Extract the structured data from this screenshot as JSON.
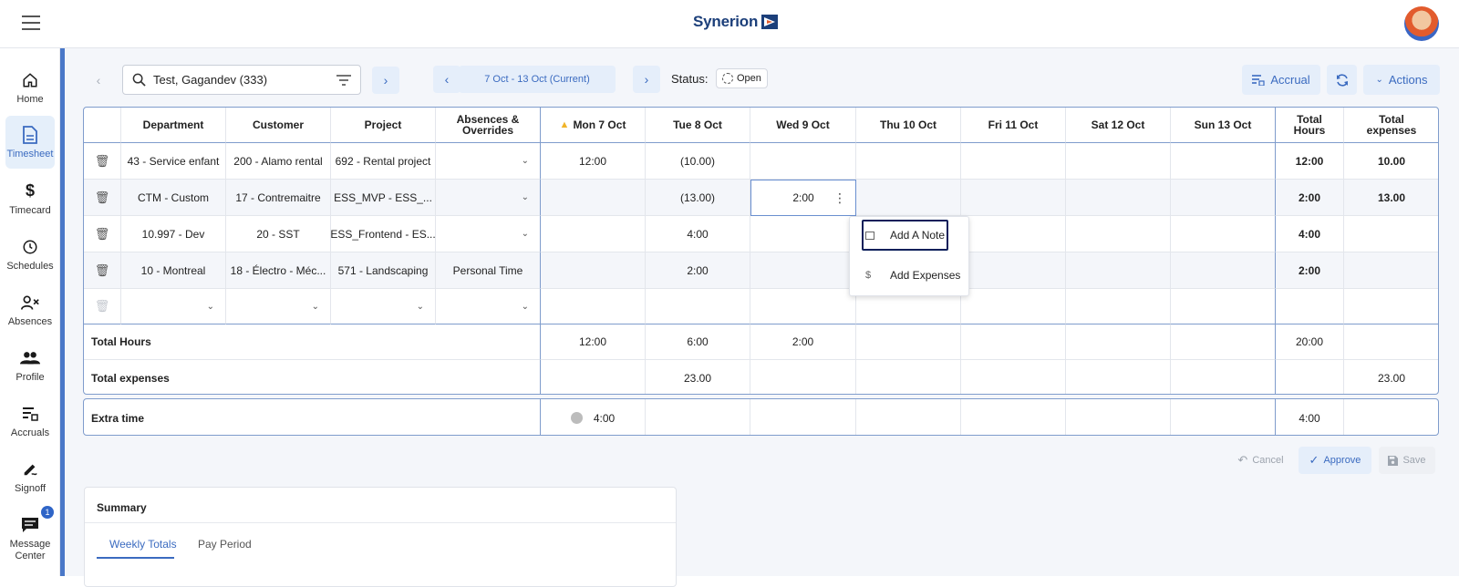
{
  "header": {
    "logo_text": "Synerion",
    "brand_color": "#1c3f7a",
    "accent_color": "#3b6bc0"
  },
  "sidebar": {
    "items": [
      {
        "label": "Home",
        "icon": "home-icon"
      },
      {
        "label": "Timesheet",
        "icon": "timesheet-icon",
        "active": true
      },
      {
        "label": "Timecard",
        "icon": "dollar-icon"
      },
      {
        "label": "Schedules",
        "icon": "clock-icon"
      },
      {
        "label": "Absences",
        "icon": "person-x-icon"
      },
      {
        "label": "Profile",
        "icon": "people-icon"
      },
      {
        "label": "Accruals",
        "icon": "accruals-icon"
      },
      {
        "label": "Signoff",
        "icon": "signoff-icon"
      },
      {
        "label": "Message Center",
        "icon": "chat-icon",
        "badge": "1"
      }
    ]
  },
  "toolbar": {
    "employee": "Test, Gagandev (333)",
    "date_range": "7 Oct - 13 Oct (Current)",
    "status_label": "Status:",
    "status_value": "Open",
    "accrual_label": "Accrual",
    "actions_label": "Actions"
  },
  "table": {
    "headers": {
      "department": "Department",
      "customer": "Customer",
      "project": "Project",
      "absences": "Absences & Overrides",
      "days": [
        "Mon 7 Oct",
        "Tue 8 Oct",
        "Wed 9 Oct",
        "Thu 10 Oct",
        "Fri 11 Oct",
        "Sat 12 Oct",
        "Sun 13 Oct"
      ],
      "total_hours": "Total Hours",
      "total_expenses": "Total expenses"
    },
    "rows": [
      {
        "department": "43 - Service enfant",
        "customer": "200 - Alamo rental",
        "project": "692 - Rental project",
        "absences": "",
        "days": [
          "12:00",
          "(10.00)",
          "",
          "",
          "",
          "",
          ""
        ],
        "total_hours": "12:00",
        "total_expenses": "10.00"
      },
      {
        "department": "CTM - Custom",
        "customer": "17 - Contremaitre",
        "project": "ESS_MVP - ESS_...",
        "absences": "",
        "days": [
          "",
          "(13.00)",
          "2:00",
          "",
          "",
          "",
          ""
        ],
        "total_hours": "2:00",
        "total_expenses": "13.00"
      },
      {
        "department": "10.997 - Dev",
        "customer": "20 - SST",
        "project": "ESS_Frontend - ES...",
        "absences": "",
        "days": [
          "",
          "4:00",
          "",
          "",
          "",
          "",
          ""
        ],
        "total_hours": "4:00",
        "total_expenses": ""
      },
      {
        "department": "10 - Montreal",
        "customer": "18 - Électro - Méc...",
        "project": "571 - Landscaping",
        "absences": "Personal Time",
        "days": [
          "",
          "2:00",
          "",
          "",
          "",
          "",
          ""
        ],
        "total_hours": "2:00",
        "total_expenses": ""
      }
    ],
    "totals_hours": {
      "label": "Total Hours",
      "days": [
        "12:00",
        "6:00",
        "2:00",
        "",
        "",
        "",
        ""
      ],
      "total_hours": "20:00",
      "total_expenses": ""
    },
    "totals_expenses": {
      "label": "Total expenses",
      "days": [
        "",
        "23.00",
        "",
        "",
        "",
        "",
        ""
      ],
      "total_hours": "",
      "total_expenses": "23.00"
    }
  },
  "extra_time": {
    "label": "Extra time",
    "mon": "4:00",
    "total_hours": "4:00"
  },
  "context_menu": {
    "items": [
      {
        "label": "Add A Note",
        "icon": "note-icon"
      },
      {
        "label": "Add Expenses",
        "icon": "dollar-icon"
      }
    ]
  },
  "footer_buttons": {
    "cancel": "Cancel",
    "approve": "Approve",
    "save": "Save"
  },
  "summary": {
    "title": "Summary",
    "tabs": [
      "Weekly Totals",
      "Pay Period"
    ]
  }
}
